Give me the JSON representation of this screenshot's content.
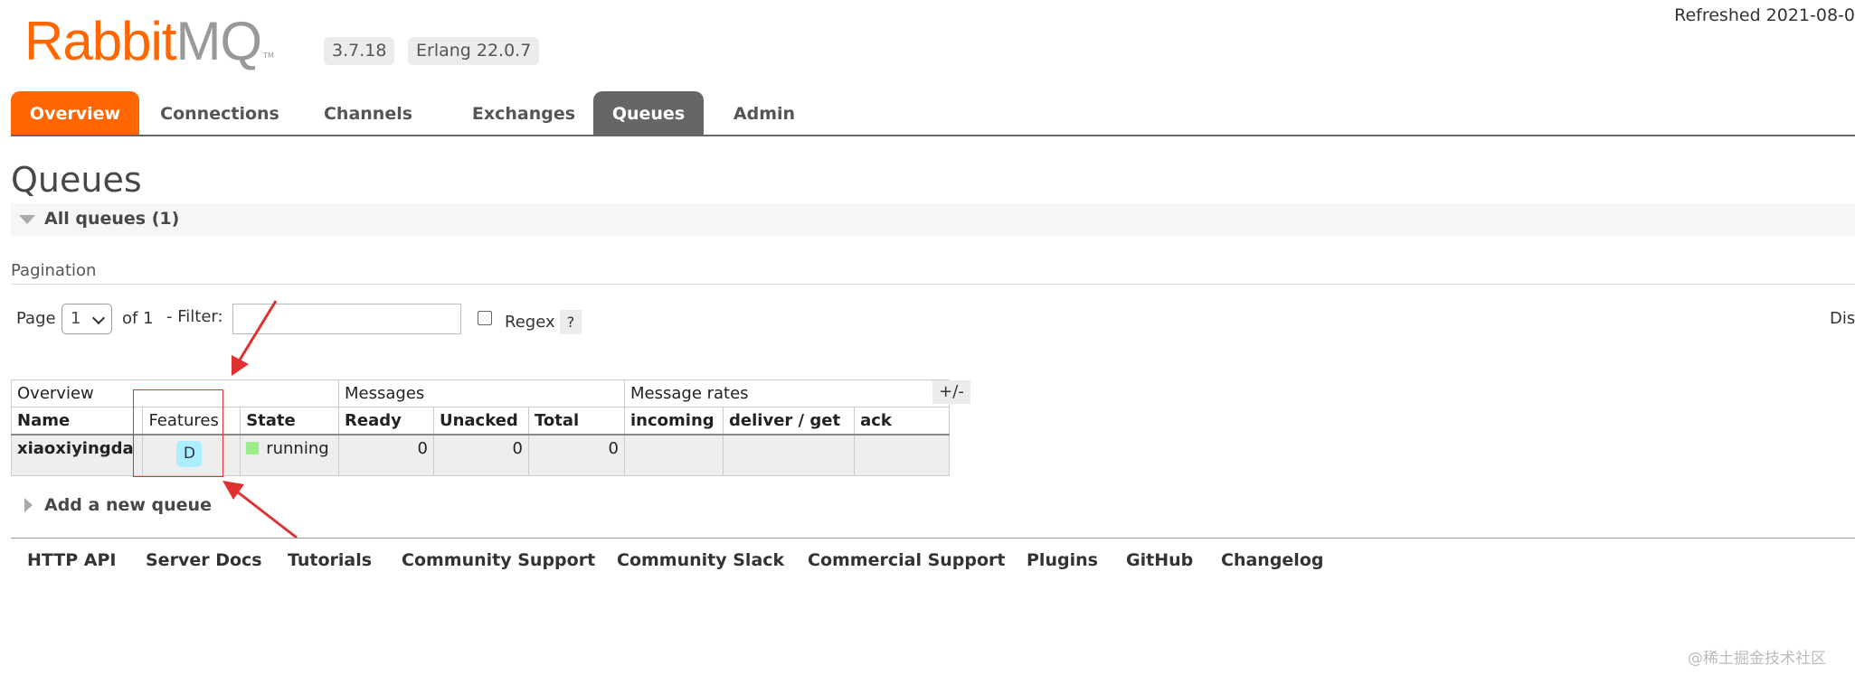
{
  "header": {
    "logo_main": "RabbitMQ",
    "logo_mq": "",
    "logo_tm": "TM",
    "version": "3.7.18",
    "erlang": "Erlang 22.0.7",
    "refreshed": "Refreshed 2021-08-0"
  },
  "tabs": [
    "Overview",
    "Connections",
    "Channels",
    "Exchanges",
    "Queues",
    "Admin"
  ],
  "page_title": "Queues",
  "section": {
    "label": "All queues (1)"
  },
  "pagination": {
    "heading": "Pagination",
    "page_label": "Page",
    "page_value": "1",
    "of_label": "of 1",
    "filter_label": "- Filter:",
    "filter_value": "",
    "regex_label": "Regex",
    "help_label": "?",
    "display_label": "Dis"
  },
  "table": {
    "groups": [
      "Overview",
      "Messages",
      "Message rates"
    ],
    "columns": [
      "Name",
      "Features",
      "State",
      "Ready",
      "Unacked",
      "Total",
      "incoming",
      "deliver / get",
      "ack"
    ],
    "rows": [
      {
        "name": "xiaoxiyingda",
        "features": "D",
        "state": "running",
        "ready": "0",
        "unacked": "0",
        "total": "0",
        "incoming": "",
        "deliver_get": "",
        "ack": ""
      }
    ],
    "plus_minus": "+/-"
  },
  "add_queue": "Add a new queue",
  "footer": [
    "HTTP API",
    "Server Docs",
    "Tutorials",
    "Community Support",
    "Community Slack",
    "Commercial Support",
    "Plugins",
    "GitHub",
    "Changelog"
  ],
  "watermark": "@稀土掘金技术社区",
  "colors": {
    "accent": "#ff6600",
    "active_tab": "#666666",
    "running": "#99ee88",
    "feature_badge": "#aaeeff",
    "annotation": "#e03030"
  }
}
